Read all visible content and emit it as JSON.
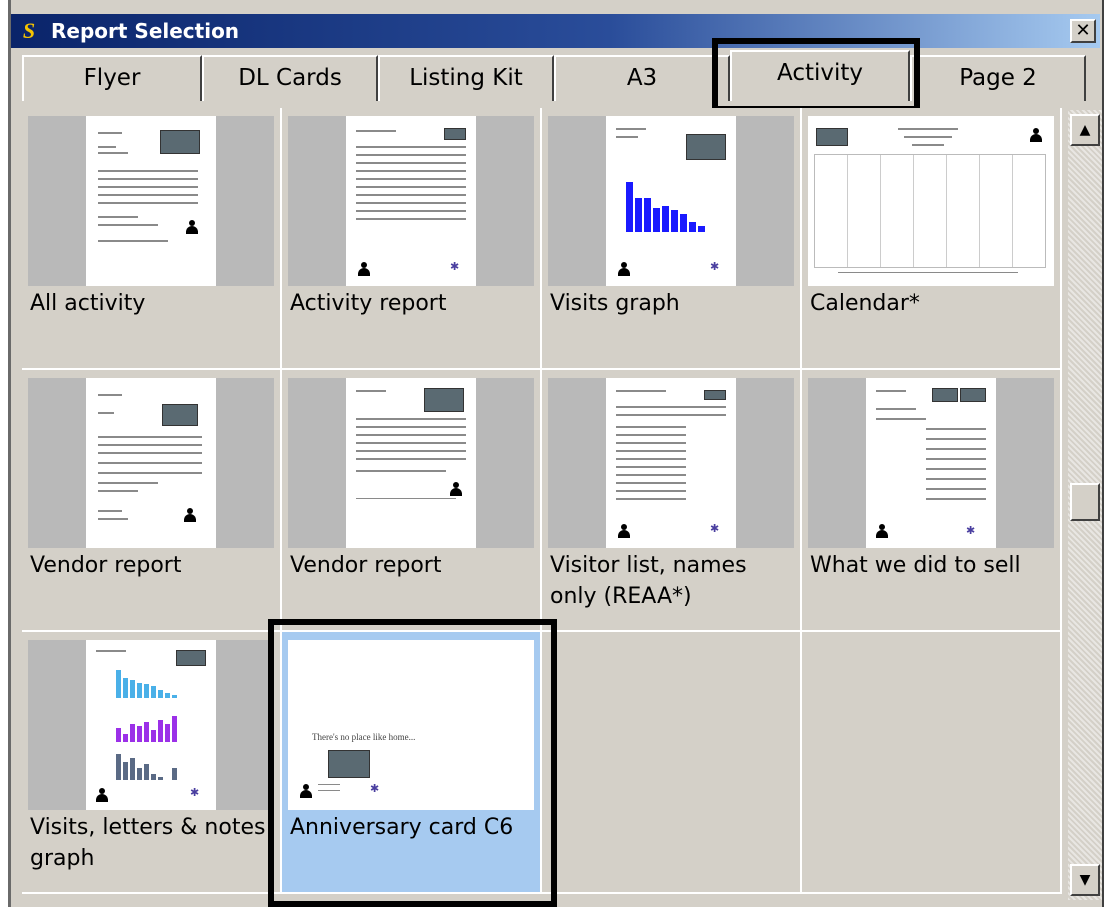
{
  "window": {
    "title": "Report Selection",
    "app_logo": "S",
    "close_label": "✕"
  },
  "tabs": [
    {
      "label": "Flyer",
      "active": false
    },
    {
      "label": "DL Cards",
      "active": false
    },
    {
      "label": "Listing Kit",
      "active": false
    },
    {
      "label": "A3",
      "active": false
    },
    {
      "label": "Activity",
      "active": true
    },
    {
      "label": "Page 2",
      "active": false
    }
  ],
  "reports": [
    {
      "label": "All activity",
      "thumbnail": "document-icon"
    },
    {
      "label": "Activity report",
      "thumbnail": "table-document-icon"
    },
    {
      "label": "Visits graph",
      "thumbnail": "bar-graph-icon"
    },
    {
      "label": "Calendar*",
      "thumbnail": "calendar-icon"
    },
    {
      "label": "Vendor report",
      "thumbnail": "document-icon"
    },
    {
      "label": "Vendor report",
      "thumbnail": "document-icon"
    },
    {
      "label": "Visitor list, names only (REAA*)",
      "thumbnail": "list-document-icon"
    },
    {
      "label": "What we did to sell",
      "thumbnail": "list-document-icon"
    },
    {
      "label": "Visits, letters & notes graph",
      "thumbnail": "multi-bar-graph-icon"
    },
    {
      "label": "Anniversary card C6",
      "thumbnail": "card-icon",
      "selected": true
    }
  ],
  "card_text": "There's no place like home...",
  "colors": {
    "title_gradient_start": "#0a246a",
    "title_gradient_end": "#a6caf0",
    "selection": "#a6caf0",
    "window_face": "#d4d0c8",
    "graph_blue": "#1a1aff",
    "graph_light_blue": "#4ab0e8",
    "graph_purple": "#9b30e8",
    "graph_slate": "#5a6a85"
  },
  "scrollbar": {
    "up_arrow": "▲",
    "down_arrow": "▼"
  }
}
